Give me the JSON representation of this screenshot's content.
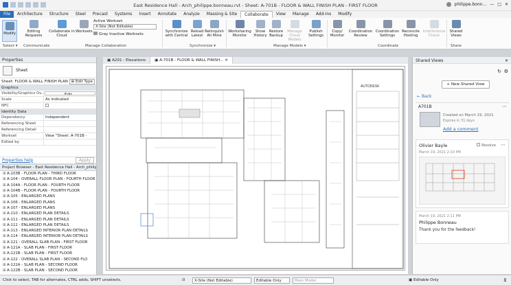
{
  "window": {
    "title": "East Residence Hall - Arch_philippe.bonneau.rvt - Sheet: A-701B - FLOOR & WALL FINISH PLAN - FIRST FLOOR",
    "user": "philippe.bonn..."
  },
  "menu": [
    "File",
    "Architecture",
    "Structure",
    "Steel",
    "Precast",
    "Systems",
    "Insert",
    "Annotate",
    "Analyze",
    "Massing & Site",
    "Collaborate",
    "View",
    "Manage",
    "Add-Ins",
    "Modify"
  ],
  "ribbon": {
    "modify": "Modify",
    "editing_requests": "Editing Requests",
    "collab_cloud": "Collaborate in Cloud",
    "worksets": "Worksets",
    "active_workset_label": "Active Workset:",
    "active_workset_value": "X-Site (Not Editable)",
    "gray_inactive": "Gray Inactive Worksets",
    "sync_central": "Synchronize with Central",
    "reload_latest": "Reload Latest",
    "relinquish_all": "Relinquish All Mine",
    "worksharing_monitor": "Worksharing Monitor",
    "show_history": "Show History",
    "restore_backup": "Restore Backup",
    "manage_cloud": "Manage Cloud Models",
    "publish_settings": "Publish Settings",
    "copy_monitor": "Copy/ Monitor",
    "coord_review": "Coordination Review",
    "coord_settings": "Coordination Settings",
    "reconcile_hosting": "Reconcile Hosting",
    "interference_check": "Interference Check",
    "shared_views": "Shared Views",
    "groups": {
      "select": "Select ▾",
      "communicate": "Communicate",
      "manage_collab": "Manage Collaboration",
      "synchronize": "Synchronize ▾",
      "manage_models": "Manage Models ▾",
      "coordinate": "Coordinate",
      "share": "Share"
    }
  },
  "properties": {
    "title": "Properties",
    "type": "Sheet",
    "selector": "Sheet: FLOOR & WALL FINISH PLAN ▾",
    "edit_type": "Edit Type",
    "graphics_cat": "Graphics",
    "rows_graphics": [
      {
        "k": "Visibility/Graphics Ov...",
        "v": "Edit..."
      },
      {
        "k": "Scale",
        "v": "As indicated"
      },
      {
        "k": "NFC",
        "v": ""
      }
    ],
    "identity_cat": "Identity Data",
    "rows_identity": [
      {
        "k": "Dependency",
        "v": "Independent"
      },
      {
        "k": "Referencing Sheet",
        "v": ""
      },
      {
        "k": "Referencing Detail",
        "v": ""
      },
      {
        "k": "Workset",
        "v": "View \"Sheet: A-701B -"
      },
      {
        "k": "Edited by",
        "v": ""
      }
    ],
    "help_link": "Properties help",
    "apply": "Apply"
  },
  "project_browser": {
    "title": "Project Browser - East Residence Hall - Arch_philipp...",
    "items": [
      "A-103B - FLOOR PLAN - THIRD FLOOR",
      "A-104 - OVERALL FLOOR PLAN - FOURTH FLOOR",
      "A-104A - FLOOR PLAN - FOURTH FLOOR",
      "A-104B - FLOOR PLAN - FOURTH FLOOR",
      "A-105 - ENLARGED PLANS",
      "A-106 - ENLARGED PLANS",
      "A-107 - ENLARGED PLANS",
      "A-110 - ENLARGED PLAN DETAILS",
      "A-111 - ENLARGED PLAN DETAILS",
      "A-112 - ENLARGED PLAN DETAILS",
      "A-113 - ENLARGED INTERIOR PLAN DETAILS",
      "A-114 - ENLARGED INTERIOR PLAN DETAILS",
      "A-121 - OVERALL SLAB PLAN - FIRST FLOOR",
      "A-121A - SLAB PLAN - FIRST FLOOR",
      "A-121B - SLAB PLAN - FIRST FLOOR",
      "A-122 - OVERALL SLAB PLAN - SECOND FLO",
      "A-122A - SLAB PLAN - SECOND FLOOR",
      "A-122B - SLAB PLAN - SECOND FLOOR"
    ]
  },
  "doc_tabs": [
    "A201 - Elevations",
    "A-701B - FLOOR & WALL FINISH..."
  ],
  "sheet": {
    "brand": "AUTODESK"
  },
  "shared_views": {
    "title": "Shared Views",
    "new_button": "New Shared View",
    "back": "Back",
    "view_name": "A701B",
    "created": "Created on March 19, 2021",
    "expires": "Expires in 31 days",
    "add_comment": "Add a comment",
    "c1_author": "Olivier Bayle",
    "resolve": "Resolve",
    "c1_date": "March 19, 2021 2:10 PM",
    "c2_date": "March 19, 2021 2:11 PM",
    "c2_author": "Philippe Bonneau",
    "c2_text": "Thank you for the feedback!"
  },
  "status": {
    "hint": "Click to select, TAB for alternates, CTRL adds, SHIFT unselects.",
    "zoom": ":0",
    "workset": "X-Site (Not Editable)",
    "editable_only": "Editable Only",
    "main_model": "Main Model"
  }
}
